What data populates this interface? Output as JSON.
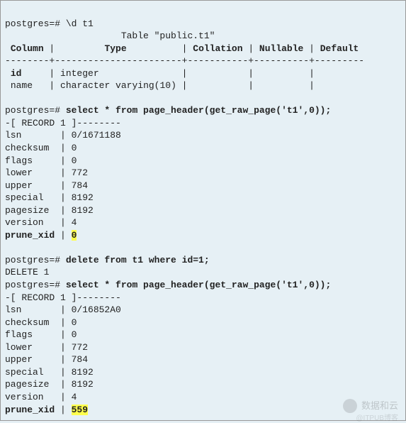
{
  "prompt": "postgres=#",
  "cmd1": "\\d t1",
  "table_title": "Table \"public.t1\"",
  "header": {
    "column": "Column",
    "type": "Type",
    "collation": "Collation",
    "nullable": "Nullable",
    "default": "Default"
  },
  "rule1": "--------+-----------------------+-----------+----------+---------",
  "columns": [
    {
      "name": "id",
      "type": "integer"
    },
    {
      "name": "name",
      "type": "character varying(10)"
    }
  ],
  "cmd2": "select * from page_header(get_raw_page('t1',0));",
  "record_hdr": "-[ RECORD 1 ]--------",
  "page_header1": {
    "lsn": "0/1671188",
    "checksum": "0",
    "flags": "0",
    "lower": "772",
    "upper": "784",
    "special": "8192",
    "pagesize": "8192",
    "version": "4",
    "prune_xid": "0"
  },
  "cmd3": "delete from t1 where id=1;",
  "delete_result": "DELETE 1",
  "cmd4": "select * from page_header(get_raw_page('t1',0));",
  "page_header2": {
    "lsn": "0/16852A0",
    "checksum": "0",
    "flags": "0",
    "lower": "772",
    "upper": "784",
    "special": "8192",
    "pagesize": "8192",
    "version": "4",
    "prune_xid": "559"
  },
  "labels": {
    "lsn": "lsn",
    "checksum": "checksum",
    "flags": "flags",
    "lower": "lower",
    "upper": "upper",
    "special": "special",
    "pagesize": "pagesize",
    "version": "version",
    "prune_xid": "prune_xid"
  },
  "watermark": {
    "text": "数据和云",
    "sub": "@ITPUB博客"
  }
}
